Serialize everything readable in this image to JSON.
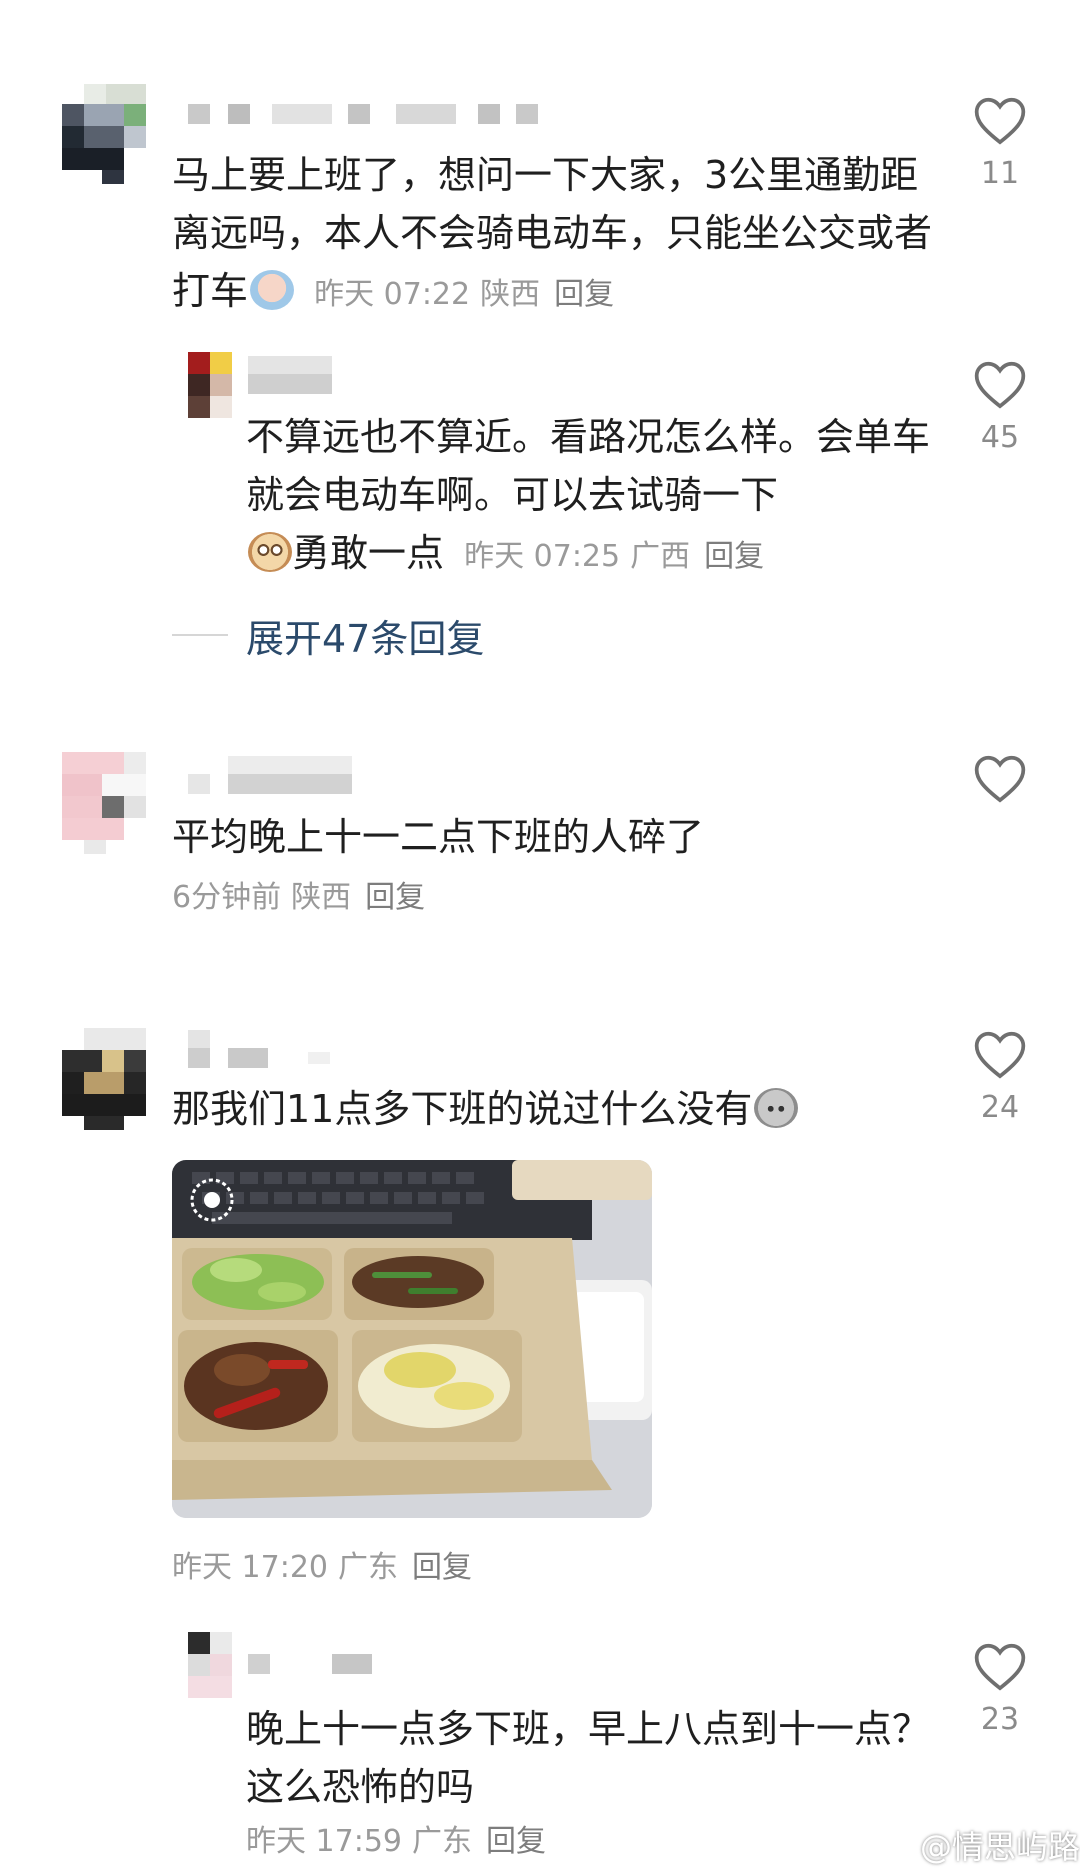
{
  "comments": [
    {
      "text": "马上要上班了，想问一下大家，3公里通勤距离远吗，本人不会骑电动车，只能坐公交或者打车",
      "time": "昨天 07:22",
      "location": "陕西",
      "reply": "回复",
      "likes": "11",
      "emoji": "crying-face-emoji",
      "replies": [
        {
          "text": "不算远也不算近。看路况怎么样。会单车就会电动车啊。可以去试骑一下",
          "text_tail": "勇敢一点",
          "time": "昨天 07:25",
          "location": "广西",
          "reply": "回复",
          "likes": "45",
          "emoji": "owl-face-emoji"
        }
      ],
      "expand_label": "展开47条回复"
    },
    {
      "text": "平均晚上十一二点下班的人碎了",
      "time": "6分钟前",
      "location": "陕西",
      "reply": "回复",
      "likes": ""
    },
    {
      "text": "那我们11点多下班的说过什么没有",
      "time": "昨天 17:20",
      "location": "广东",
      "reply": "回复",
      "likes": "24",
      "emoji": "sad-face-emoji",
      "image": "food-lunchbox-photo",
      "replies": [
        {
          "text": "晚上十一点多下班，早上八点到十一点？这么恐怖的吗",
          "time": "昨天 17:59",
          "location": "广东",
          "reply": "回复",
          "likes": "23"
        }
      ]
    }
  ],
  "watermark": "@情思屿路",
  "colors": {
    "text": "#1f1f1f",
    "meta": "#9a9a9a",
    "link": "#2b4a6b",
    "heart": "#6f6f6f"
  }
}
